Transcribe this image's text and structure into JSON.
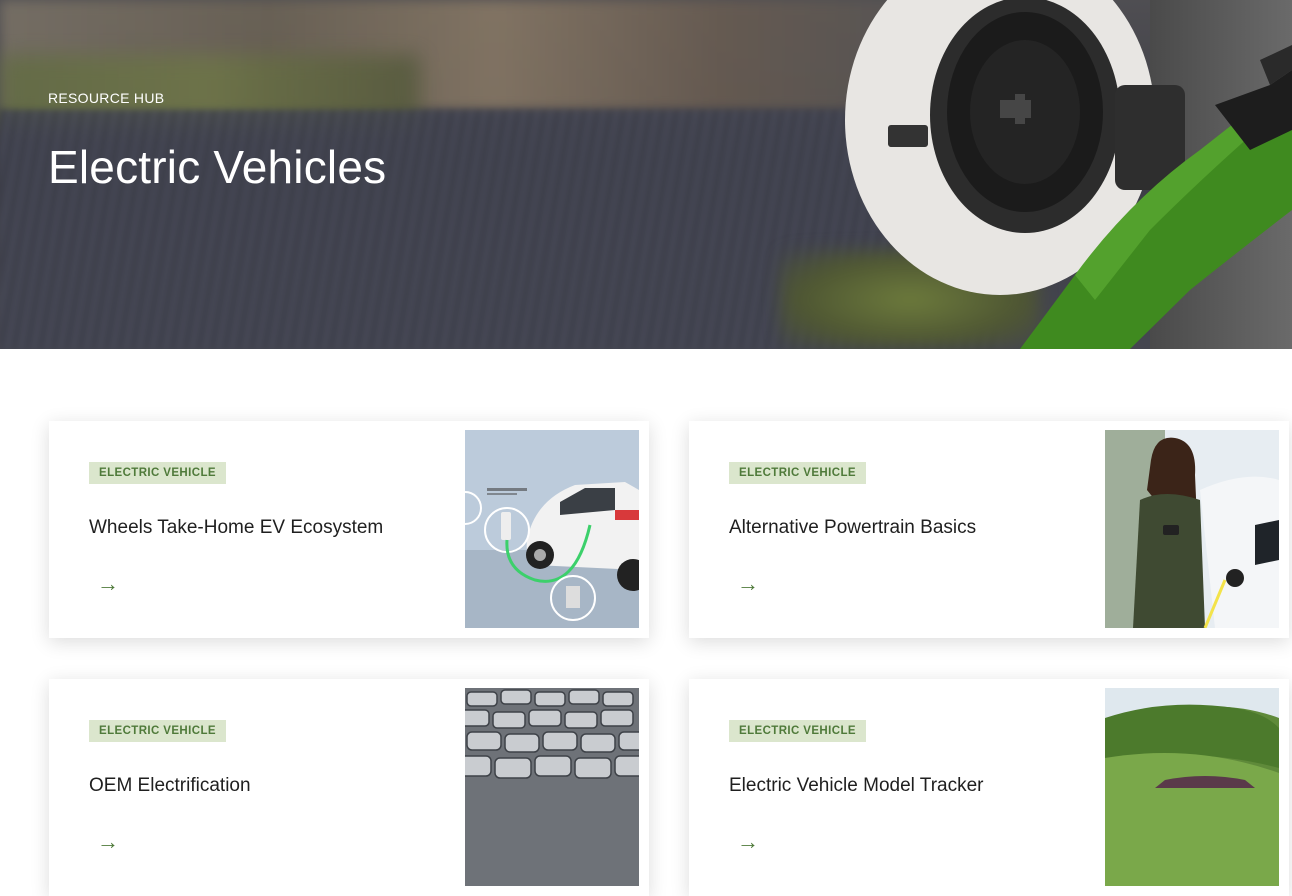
{
  "hero": {
    "eyebrow": "RESOURCE HUB",
    "title": "Electric Vehicles"
  },
  "cards": [
    {
      "tag": "ELECTRIC VEHICLE",
      "title": "Wheels Take-Home EV Ecosystem",
      "arrow": "→",
      "image": "ev-charging-diagram-illustration"
    },
    {
      "tag": "ELECTRIC VEHICLE",
      "title": "Alternative Powertrain Basics",
      "arrow": "→",
      "image": "woman-charging-ev-photo"
    },
    {
      "tag": "ELECTRIC VEHICLE",
      "title": "OEM Electrification",
      "arrow": "→",
      "image": "parked-cars-lot-photo"
    },
    {
      "tag": "ELECTRIC VEHICLE",
      "title": "Electric Vehicle Model Tracker",
      "arrow": "→",
      "image": "car-on-green-hills-photo"
    }
  ],
  "colors": {
    "accent_green": "#4f7a3a",
    "tag_bg": "#dbe6cd",
    "charger_green": "#3f8a1f"
  }
}
